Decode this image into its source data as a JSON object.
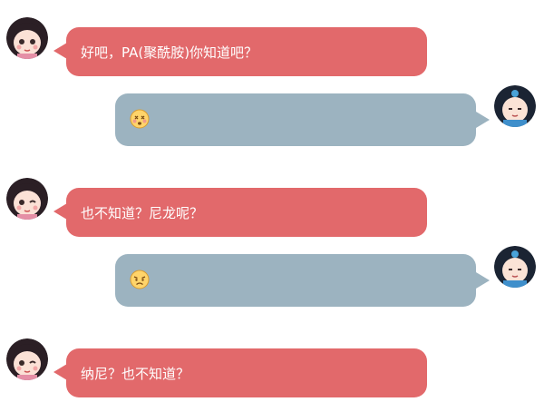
{
  "messages": [
    {
      "side": "left",
      "avatar": "girl-avatar",
      "text": "好吧，PA(聚酰胺)你知道吧？"
    },
    {
      "side": "right",
      "avatar": "boy-avatar",
      "emoji": "dizzy-face-emoji"
    },
    {
      "side": "left",
      "avatar": "girl-winking-avatar",
      "text": "也不知道？尼龙呢？"
    },
    {
      "side": "right",
      "avatar": "boy-avatar",
      "emoji": "worried-face-emoji"
    },
    {
      "side": "left",
      "avatar": "girl-winking-avatar",
      "text": "纳尼？也不知道？"
    }
  ],
  "colors": {
    "left_bubble": "#e2696b",
    "right_bubble": "#9cb3c0",
    "text": "#ffffff"
  }
}
